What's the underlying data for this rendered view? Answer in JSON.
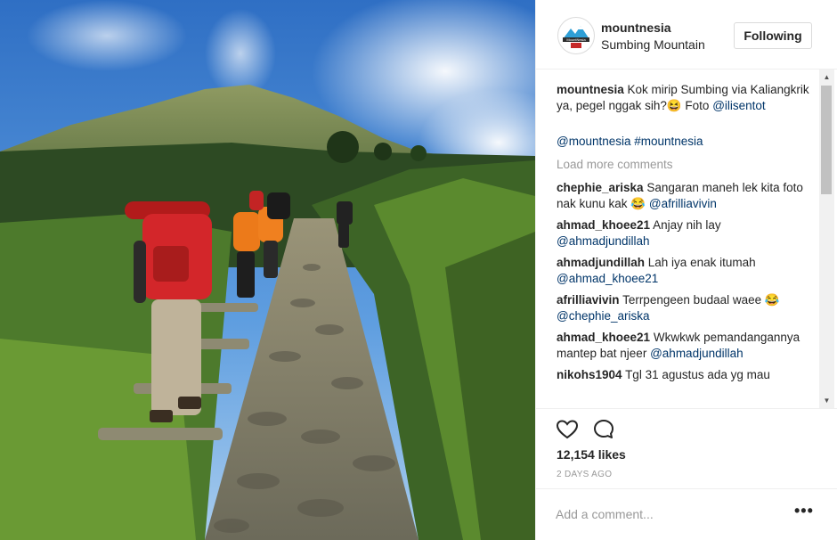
{
  "post": {
    "username": "mountnesia",
    "location": "Sumbing Mountain",
    "follow_label": "Following",
    "likes": "12,154 likes",
    "date": "2 DAYS AGO",
    "add_comment_placeholder": "Add a comment...",
    "more_label": "•••",
    "logo_text": "MountNesia"
  },
  "caption": {
    "user": "mountnesia",
    "text": "Kok mirip Sumbing via Kaliangkrik ya, pegel nggak sih?😆 Foto",
    "mention": "@ilisentot",
    "tags": "@mountnesia #mountnesia"
  },
  "load_more": "Load more comments",
  "comments": [
    {
      "user": "chephie_ariska",
      "text": "Sangaran maneh lek kita foto nak kunu kak 😂",
      "mention": "@afrilliavivin"
    },
    {
      "user": "ahmad_khoee21",
      "text": "Anjay nih lay",
      "mention": "@ahmadjundillah"
    },
    {
      "user": "ahmadjundillah",
      "text": "Lah iya enak itumah",
      "mention": "@ahmad_khoee21"
    },
    {
      "user": "afrilliavivin",
      "text": "Terrpengeen budaal waee 😂",
      "mention": "@chephie_ariska"
    },
    {
      "user": "ahmad_khoee21",
      "text": "Wkwkwk pemandangannya mantep bat njeer",
      "mention": "@ahmadjundillah"
    },
    {
      "user": "nikohs1904",
      "text": "Tgl 31 agustus ada yg mau",
      "mention": ""
    }
  ],
  "colors": {
    "link": "#003569",
    "muted": "#999999",
    "text": "#262626"
  }
}
